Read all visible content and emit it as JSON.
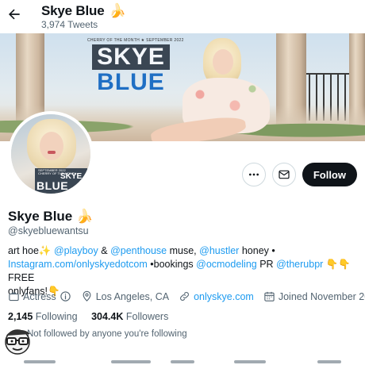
{
  "topbar": {
    "back_icon": "arrow-left-icon",
    "title": "Skye Blue",
    "title_emoji": "🍌",
    "tweet_count": "3,974 Tweets"
  },
  "banner": {
    "kicker": "CHERRY OF THE MONTH ★ SEPTEMBER 2022",
    "title_line1": "SKYE",
    "title_line2": "BLUE"
  },
  "avatar": {
    "kicker": "SEPTEMBER 2022",
    "kicker2": "CHERRY OF THE MONTH",
    "t1": "SKYE",
    "t2": "BLUE"
  },
  "actions": {
    "more_icon": "more-dots-icon",
    "message_icon": "envelope-icon",
    "follow_label": "Follow"
  },
  "profile": {
    "name": "Skye Blue",
    "name_emoji": "🍌",
    "handle": "@skyebluewantsu"
  },
  "bio": {
    "p1": "art hoe",
    "sparkle": "✨",
    "m1": "@playboy",
    "amp": " & ",
    "m2": "@penthouse",
    "muse": " muse, ",
    "m3": "@hustler",
    "honey": " honey •",
    "url": "Instagram.com/onlyskyedotcom",
    "bookings": " •bookings ",
    "m4": "@ocmodeling",
    "pr": " PR ",
    "m5": "@therubpr",
    "hands": " 👇👇 ",
    "free": "FREE",
    "onlyfans": "onlyfans!",
    "hand2": "👇"
  },
  "meta": {
    "category": "Actress",
    "location": "Los Angeles, CA",
    "website": "onlyskye.com",
    "joined": "Joined November 2017"
  },
  "stats": {
    "following_count": "2,145",
    "following_label": "Following",
    "followers_count": "304.4K",
    "followers_label": "Followers"
  },
  "followed_by": "Not followed by anyone you're following"
}
